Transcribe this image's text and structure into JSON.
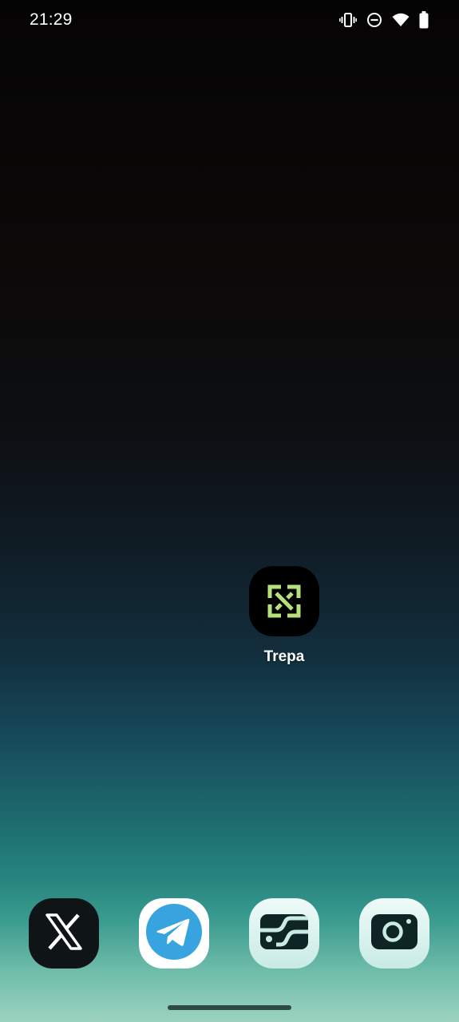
{
  "status_bar": {
    "time": "21:29",
    "icons": [
      "vibrate-icon",
      "do-not-disturb-icon",
      "wifi-icon",
      "battery-icon"
    ]
  },
  "home": {
    "apps": [
      {
        "label": "Trepa",
        "icon": "trepa-logo-icon",
        "accent": "#b7e07a"
      }
    ]
  },
  "dock": {
    "apps": [
      {
        "icon": "x-logo-icon"
      },
      {
        "icon": "telegram-icon",
        "accent": "#37a4e0"
      },
      {
        "icon": "wallet-icon"
      },
      {
        "icon": "camera-icon"
      }
    ]
  }
}
